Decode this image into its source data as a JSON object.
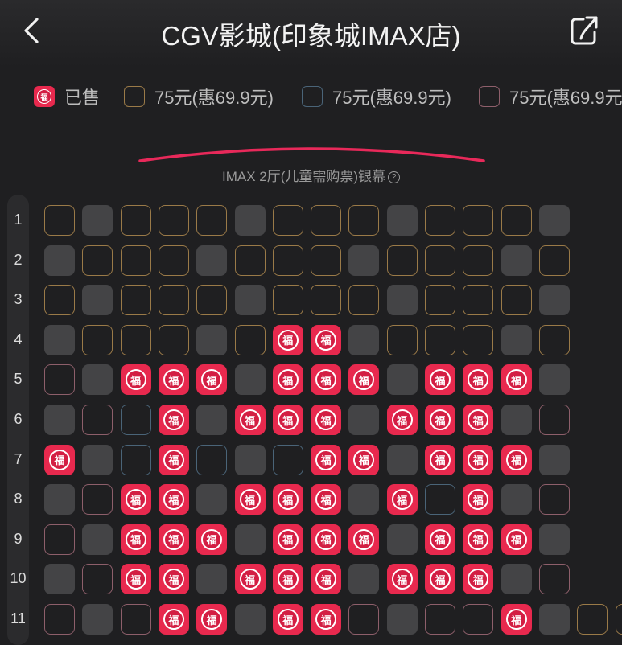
{
  "header": {
    "title": "CGV影城(印象城IMAX店)"
  },
  "legend": [
    {
      "label": "已售",
      "kind": "sold"
    },
    {
      "label": "75元(惠69.9元)",
      "kind": "gold"
    },
    {
      "label": "75元(惠69.9元)",
      "kind": "blue"
    },
    {
      "label": "75元(惠69.9元",
      "kind": "pink"
    }
  ],
  "screen": {
    "label": "IMAX 2厅(儿童需购票)银幕",
    "help_glyph": "?"
  },
  "seat_glyph": "福",
  "rows": [
    {
      "label": "1",
      "seats": [
        "gold",
        "grey",
        "gold",
        "gold",
        "gold",
        "grey",
        "gold",
        "gold",
        "gold",
        "grey",
        "gold",
        "gold",
        "gold",
        "grey"
      ]
    },
    {
      "label": "2",
      "seats": [
        "grey",
        "gold",
        "gold",
        "gold",
        "grey",
        "gold",
        "gold",
        "gold",
        "grey",
        "gold",
        "gold",
        "gold",
        "grey",
        "gold"
      ]
    },
    {
      "label": "3",
      "seats": [
        "gold",
        "grey",
        "gold",
        "gold",
        "gold",
        "grey",
        "gold",
        "gold",
        "gold",
        "grey",
        "gold",
        "gold",
        "gold",
        "grey"
      ]
    },
    {
      "label": "4",
      "seats": [
        "grey",
        "gold",
        "gold",
        "gold",
        "grey",
        "gold",
        "sold",
        "sold",
        "grey",
        "gold",
        "gold",
        "gold",
        "grey",
        "gold"
      ]
    },
    {
      "label": "5",
      "seats": [
        "pink",
        "grey",
        "sold",
        "sold",
        "sold",
        "grey",
        "sold",
        "sold",
        "sold",
        "grey",
        "sold",
        "sold",
        "sold",
        "grey"
      ]
    },
    {
      "label": "6",
      "seats": [
        "grey",
        "pink",
        "blue",
        "sold",
        "grey",
        "sold",
        "sold",
        "sold",
        "grey",
        "sold",
        "sold",
        "sold",
        "grey",
        "pink"
      ]
    },
    {
      "label": "7",
      "seats": [
        "sold",
        "grey",
        "blue",
        "sold",
        "blue",
        "grey",
        "blue",
        "sold",
        "sold",
        "grey",
        "sold",
        "sold",
        "sold",
        "grey"
      ]
    },
    {
      "label": "8",
      "seats": [
        "grey",
        "pink",
        "sold",
        "sold",
        "grey",
        "sold",
        "sold",
        "sold",
        "grey",
        "sold",
        "blue",
        "sold",
        "grey",
        "pink"
      ]
    },
    {
      "label": "9",
      "seats": [
        "pink",
        "grey",
        "sold",
        "sold",
        "sold",
        "grey",
        "sold",
        "sold",
        "sold",
        "grey",
        "sold",
        "sold",
        "sold",
        "grey"
      ]
    },
    {
      "label": "10",
      "seats": [
        "grey",
        "pink",
        "sold",
        "sold",
        "grey",
        "sold",
        "sold",
        "sold",
        "grey",
        "sold",
        "sold",
        "sold",
        "grey",
        "pink"
      ]
    },
    {
      "label": "11",
      "seats": [
        "pink",
        "grey",
        "pink",
        "sold",
        "sold",
        "grey",
        "sold",
        "sold",
        "pink",
        "grey",
        "pink",
        "pink",
        "sold",
        "grey",
        "gold",
        "gold"
      ]
    }
  ]
}
